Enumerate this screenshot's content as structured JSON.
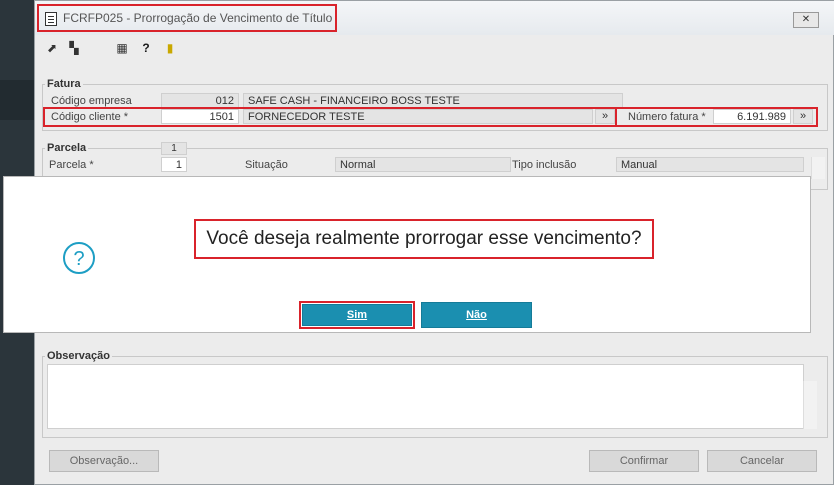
{
  "window": {
    "title": "FCRFP025 - Prorrogação de Vencimento de Título",
    "close_label": "✕"
  },
  "toolbar": {
    "icons": [
      "arrow-up-right-icon",
      "windows-icon",
      "calendar-icon",
      "help-icon",
      "exit-door-icon"
    ]
  },
  "fatura": {
    "title": "Fatura",
    "codigo_empresa_label": "Código empresa",
    "codigo_empresa_value": "012",
    "empresa_nome": "SAFE CASH - FINANCEIRO BOSS TESTE",
    "codigo_cliente_label": "Código cliente *",
    "codigo_cliente_value": "1501",
    "cliente_nome": "FORNECEDOR TESTE",
    "numero_fatura_label": "Número fatura *",
    "numero_fatura_value": "6.191.989"
  },
  "parcela": {
    "title": "Parcela",
    "index_badge": "1",
    "parcela_label": "Parcela *",
    "parcela_value": "1",
    "situacao_label": "Situação",
    "situacao_value": "Normal",
    "tipo_inclusao_label": "Tipo inclusão",
    "tipo_inclusao_value": "Manual"
  },
  "dialog": {
    "message": "Você deseja realmente prorrogar esse vencimento?",
    "yes_label": "Sim",
    "no_label": "Não"
  },
  "observacao": {
    "title": "Observação"
  },
  "footer": {
    "observacao_button": "Observação...",
    "confirmar_button": "Confirmar",
    "cancelar_button": "Cancelar"
  },
  "colors": {
    "accent": "#1b8fb0",
    "highlight_frame": "#d9232b"
  }
}
